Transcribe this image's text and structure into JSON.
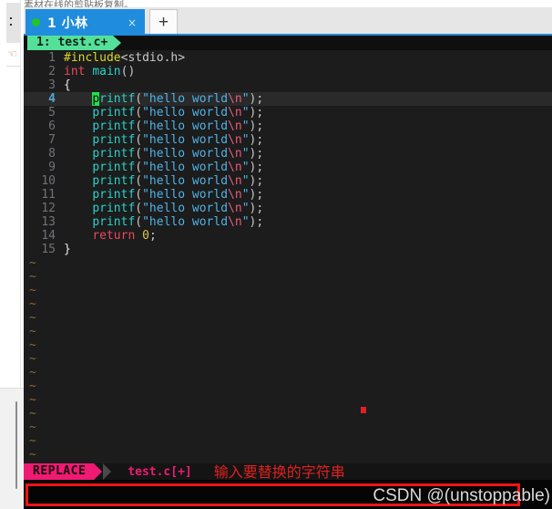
{
  "background": {
    "top_text": "素材在线的剪贴板复制。",
    "rail_icon": "hand-icon"
  },
  "terminal": {
    "tab": {
      "status_icon": "green-dot-icon",
      "label": "1 小林",
      "close_icon": "×",
      "add_icon": "+"
    },
    "airline_buffer": "1: test.c+",
    "statusline": {
      "mode": "REPLACE",
      "file": "test.c[+]",
      "annotation": "输入要替换的字符串"
    },
    "command_line": {
      "value": "",
      "placeholder": ""
    },
    "watermark": "CSDN @(unstoppable)"
  },
  "editor": {
    "lines": [
      {
        "n": "1",
        "current": false,
        "tokens": [
          {
            "t": "#include",
            "c": "c-inc"
          },
          {
            "t": "<stdio.h>",
            "c": "c-pun"
          }
        ]
      },
      {
        "n": "2",
        "current": false,
        "tokens": [
          {
            "t": "int",
            "c": "c-kw"
          },
          {
            "t": " ",
            "c": "c-pun"
          },
          {
            "t": "main",
            "c": "c-fn"
          },
          {
            "t": "()",
            "c": "c-pun"
          }
        ]
      },
      {
        "n": "3",
        "current": false,
        "tokens": [
          {
            "t": "{",
            "c": "c-brc"
          }
        ]
      },
      {
        "n": "4",
        "current": true,
        "tokens": [
          {
            "t": "    ",
            "c": "c-pun"
          },
          {
            "t": "p",
            "c": "cursor"
          },
          {
            "t": "rintf",
            "c": "c-fn"
          },
          {
            "t": "(",
            "c": "c-pun"
          },
          {
            "t": "\"hello world",
            "c": "c-str"
          },
          {
            "t": "\\n",
            "c": "c-esc"
          },
          {
            "t": "\"",
            "c": "c-str"
          },
          {
            "t": ");",
            "c": "c-pun"
          }
        ]
      },
      {
        "n": "5",
        "current": false,
        "tokens": [
          {
            "t": "    ",
            "c": "c-pun"
          },
          {
            "t": "printf",
            "c": "c-fn"
          },
          {
            "t": "(",
            "c": "c-pun"
          },
          {
            "t": "\"hello world",
            "c": "c-str"
          },
          {
            "t": "\\n",
            "c": "c-esc"
          },
          {
            "t": "\"",
            "c": "c-str"
          },
          {
            "t": ");",
            "c": "c-pun"
          }
        ]
      },
      {
        "n": "6",
        "current": false,
        "tokens": [
          {
            "t": "    ",
            "c": "c-pun"
          },
          {
            "t": "printf",
            "c": "c-fn"
          },
          {
            "t": "(",
            "c": "c-pun"
          },
          {
            "t": "\"hello world",
            "c": "c-str"
          },
          {
            "t": "\\n",
            "c": "c-esc"
          },
          {
            "t": "\"",
            "c": "c-str"
          },
          {
            "t": ");",
            "c": "c-pun"
          }
        ]
      },
      {
        "n": "7",
        "current": false,
        "tokens": [
          {
            "t": "    ",
            "c": "c-pun"
          },
          {
            "t": "printf",
            "c": "c-fn"
          },
          {
            "t": "(",
            "c": "c-pun"
          },
          {
            "t": "\"hello world",
            "c": "c-str"
          },
          {
            "t": "\\n",
            "c": "c-esc"
          },
          {
            "t": "\"",
            "c": "c-str"
          },
          {
            "t": ");",
            "c": "c-pun"
          }
        ]
      },
      {
        "n": "8",
        "current": false,
        "tokens": [
          {
            "t": "    ",
            "c": "c-pun"
          },
          {
            "t": "printf",
            "c": "c-fn"
          },
          {
            "t": "(",
            "c": "c-pun"
          },
          {
            "t": "\"hello world",
            "c": "c-str"
          },
          {
            "t": "\\n",
            "c": "c-esc"
          },
          {
            "t": "\"",
            "c": "c-str"
          },
          {
            "t": ");",
            "c": "c-pun"
          }
        ]
      },
      {
        "n": "9",
        "current": false,
        "tokens": [
          {
            "t": "    ",
            "c": "c-pun"
          },
          {
            "t": "printf",
            "c": "c-fn"
          },
          {
            "t": "(",
            "c": "c-pun"
          },
          {
            "t": "\"hello world",
            "c": "c-str"
          },
          {
            "t": "\\n",
            "c": "c-esc"
          },
          {
            "t": "\"",
            "c": "c-str"
          },
          {
            "t": ");",
            "c": "c-pun"
          }
        ]
      },
      {
        "n": "10",
        "current": false,
        "tokens": [
          {
            "t": "    ",
            "c": "c-pun"
          },
          {
            "t": "printf",
            "c": "c-fn"
          },
          {
            "t": "(",
            "c": "c-pun"
          },
          {
            "t": "\"hello world",
            "c": "c-str"
          },
          {
            "t": "\\n",
            "c": "c-esc"
          },
          {
            "t": "\"",
            "c": "c-str"
          },
          {
            "t": ");",
            "c": "c-pun"
          }
        ]
      },
      {
        "n": "11",
        "current": false,
        "tokens": [
          {
            "t": "    ",
            "c": "c-pun"
          },
          {
            "t": "printf",
            "c": "c-fn"
          },
          {
            "t": "(",
            "c": "c-pun"
          },
          {
            "t": "\"hello world",
            "c": "c-str"
          },
          {
            "t": "\\n",
            "c": "c-esc"
          },
          {
            "t": "\"",
            "c": "c-str"
          },
          {
            "t": ");",
            "c": "c-pun"
          }
        ]
      },
      {
        "n": "12",
        "current": false,
        "tokens": [
          {
            "t": "    ",
            "c": "c-pun"
          },
          {
            "t": "printf",
            "c": "c-fn"
          },
          {
            "t": "(",
            "c": "c-pun"
          },
          {
            "t": "\"hello world",
            "c": "c-str"
          },
          {
            "t": "\\n",
            "c": "c-esc"
          },
          {
            "t": "\"",
            "c": "c-str"
          },
          {
            "t": ");",
            "c": "c-pun"
          }
        ]
      },
      {
        "n": "13",
        "current": false,
        "tokens": [
          {
            "t": "    ",
            "c": "c-pun"
          },
          {
            "t": "printf",
            "c": "c-fn"
          },
          {
            "t": "(",
            "c": "c-pun"
          },
          {
            "t": "\"hello world",
            "c": "c-str"
          },
          {
            "t": "\\n",
            "c": "c-esc"
          },
          {
            "t": "\"",
            "c": "c-str"
          },
          {
            "t": ");",
            "c": "c-pun"
          }
        ]
      },
      {
        "n": "14",
        "current": false,
        "tokens": [
          {
            "t": "    ",
            "c": "c-pun"
          },
          {
            "t": "return",
            "c": "c-ret"
          },
          {
            "t": " ",
            "c": "c-pun"
          },
          {
            "t": "0",
            "c": "c-num"
          },
          {
            "t": ";",
            "c": "c-pun"
          }
        ]
      },
      {
        "n": "15",
        "current": false,
        "tokens": [
          {
            "t": "}",
            "c": "c-brc"
          }
        ]
      }
    ],
    "empty_marker": "~",
    "empty_line_count": 16
  }
}
